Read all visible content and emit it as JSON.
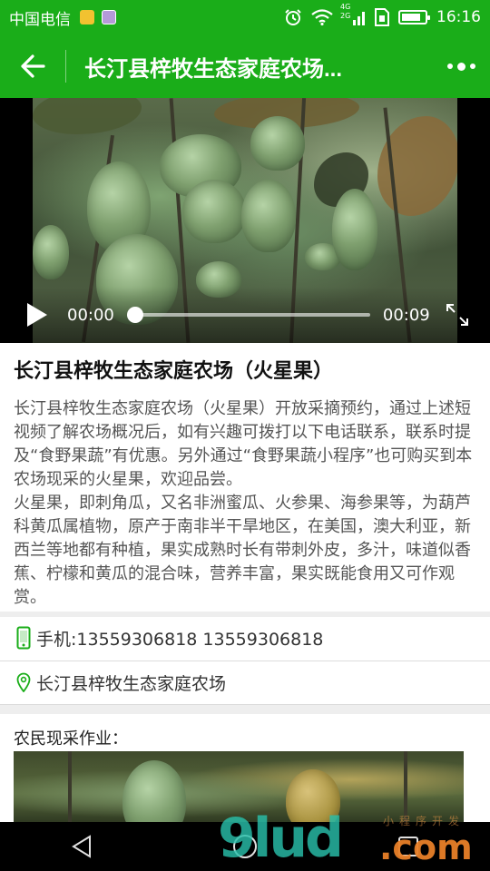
{
  "status_bar": {
    "carrier": "中国电信",
    "network_small": "4G",
    "network_small2": "2G",
    "time": "16:16"
  },
  "header": {
    "title": "长汀县梓牧生态家庭农场..."
  },
  "video": {
    "current_time": "00:00",
    "total_time": "00:09",
    "progress": 0
  },
  "article": {
    "title": "长汀县梓牧生态家庭农场（火星果）",
    "paragraph_1": "长汀县梓牧生态家庭农场（火星果）开放采摘预约，通过上述短视频了解农场概况后，如有兴趣可拨打以下电话联系，联系时提及“食野果蔬”有优惠。另外通过“食野果蔬小程序”也可购买到本农场现采的火星果，欢迎品尝。",
    "paragraph_2": "火星果，即刺角瓜，又名非洲蜜瓜、火参果、海参果等，为葫芦科黄瓜属植物，原产于南非半干旱地区，在美国，澳大利亚，新西兰等地都有种植，果实成熟时长有带刺外皮，多汁，味道似香蕉、柠檬和黄瓜的混合味，营养丰富，果实既能食用又可作观赏。"
  },
  "contact": {
    "phone_text": "手机:13559306818 13559306818",
    "address_text": "长汀县梓牧生态家庭农场"
  },
  "section": {
    "heading": "农民现采作业："
  },
  "watermark": {
    "main": "9lud",
    "suffix": ".com",
    "small": "小程序开发"
  },
  "colors": {
    "brand_green": "#1aad19",
    "phone_icon": "#1aad19",
    "location_icon": "#1aad19"
  }
}
